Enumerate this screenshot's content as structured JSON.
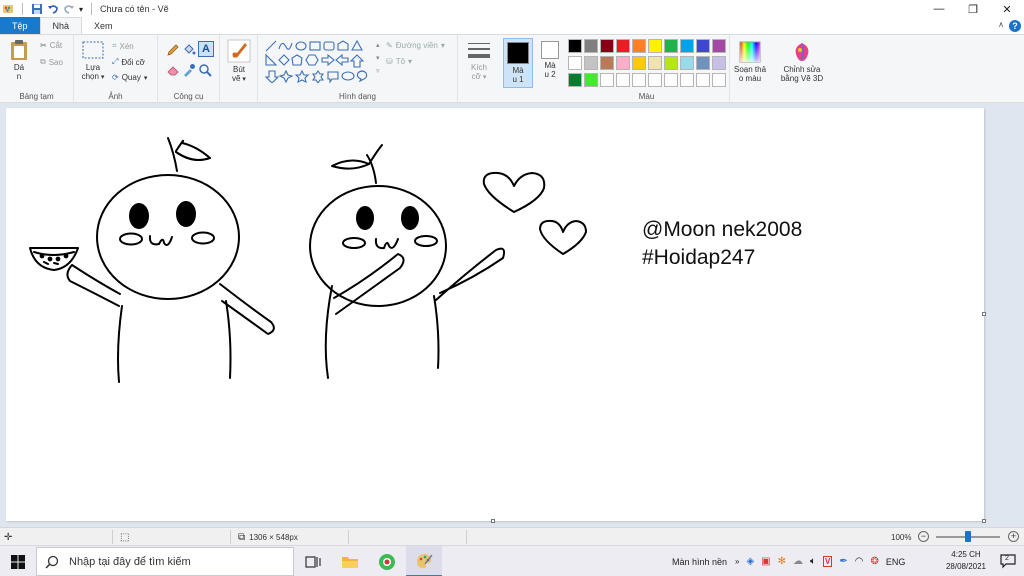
{
  "window": {
    "title": "Chưa có tên - Vẽ",
    "controls": {
      "minimize": "—",
      "restore": "❐",
      "close": "✕"
    }
  },
  "tabs": [
    {
      "label": "Tệp"
    },
    {
      "label": "Nhà"
    },
    {
      "label": "Xem"
    }
  ],
  "ribbon": {
    "clipboard": {
      "paste": "Dá\nn",
      "cut": "Cắt",
      "copy": "Sao",
      "label": "Bảng tạm"
    },
    "image": {
      "select": "Lựa\nchọn",
      "crop": "Xén",
      "resize": "Đổi cỡ",
      "rotate": "Quay",
      "label": "Ảnh"
    },
    "tools": {
      "label": "Công cụ"
    },
    "brushes": {
      "label": "Bút\nvẽ"
    },
    "shapes": {
      "outline": "Đường viền",
      "fill": "Tô",
      "label": "Hình dạng"
    },
    "size": {
      "label": "Kích\ncỡ"
    },
    "color1": {
      "label": "Mà\nu 1"
    },
    "color2": {
      "label": "Mà\nu 2"
    },
    "colors": {
      "label": "Màu"
    },
    "edit_colors": {
      "label": "Soạn thả\no màu"
    },
    "paint3d": {
      "label": "Chỉnh sửa\nbằng Vẽ 3D"
    }
  },
  "palette": {
    "row1": [
      "#000000",
      "#7f7f7f",
      "#880015",
      "#ed1c24",
      "#ff7f27",
      "#fff200",
      "#22b14c",
      "#00a2e8",
      "#3f48cc",
      "#a349a4"
    ],
    "row2": [
      "#ffffff",
      "#c3c3c3",
      "#b97a57",
      "#ffaec9",
      "#ffc90e",
      "#efe4b0",
      "#b5e61d",
      "#99d9ea",
      "#7092be",
      "#c8bfe7"
    ],
    "row3": [
      "#0b7a2f",
      "#45e830",
      "#ffffff",
      "#ffffff",
      "#ffffff",
      "#ffffff",
      "#ffffff",
      "#ffffff",
      "#ffffff",
      "#ffffff"
    ]
  },
  "canvas": {
    "signature_line1": "@Moon nek2008",
    "signature_line2": "#Hoidap247"
  },
  "statusbar": {
    "dimensions": "1306 × 548px",
    "zoom": "100%",
    "zoom_out": "−",
    "zoom_in": "+"
  },
  "taskbar": {
    "search_placeholder": "Nhập tại đây để tìm kiếm",
    "desktop": "Màn hình nền",
    "language": "ENG",
    "time": "4:25 CH",
    "date": "28/08/2021",
    "notification_count": "2"
  }
}
